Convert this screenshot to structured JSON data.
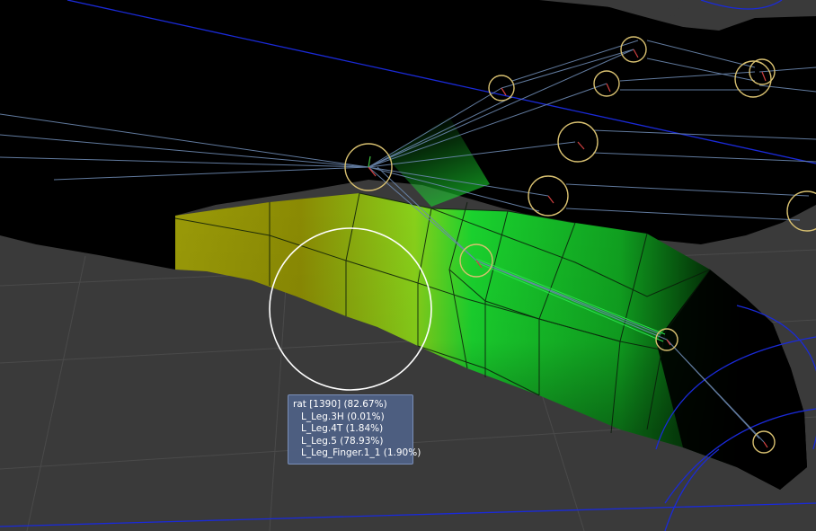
{
  "viewport": {
    "background_color": "#3a3a3a",
    "mesh_colors": {
      "black": "#000000",
      "yellow": "#9a9a08",
      "green": "#1ad22e"
    },
    "bone_color": "#6c88b0",
    "joint_color": "#d8c070",
    "guide_color": "#1a2ad8",
    "brush_color": "#ffffff"
  },
  "weight_tooltip": {
    "header": "rat [1390] (82.67%)",
    "influences": [
      "L_Leg.3H (0.01%)",
      "L_Leg.4T (1.84%)",
      "L_Leg.5 (78.93%)",
      "L_Leg_Finger.1_1 (1.90%)"
    ]
  }
}
